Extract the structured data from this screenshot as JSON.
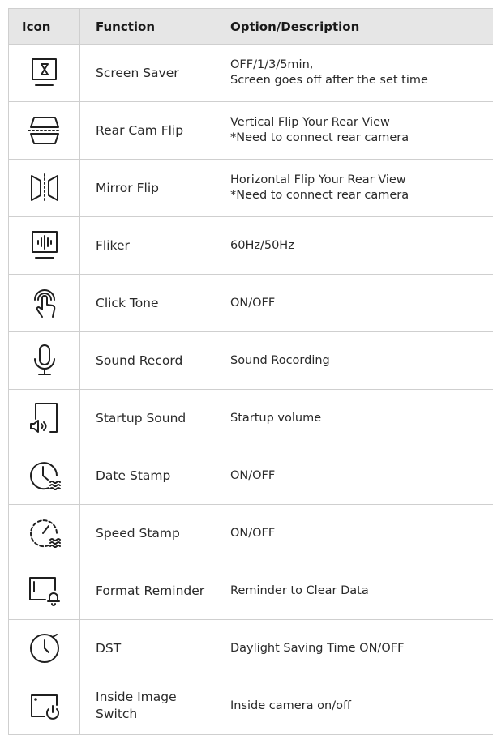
{
  "header": {
    "icon": "Icon",
    "function": "Function",
    "description": "Option/Description"
  },
  "rows": [
    {
      "icon": "screen-saver-icon",
      "function": "Screen Saver",
      "description": [
        "OFF/1/3/5min,",
        "Screen goes off after the set time"
      ]
    },
    {
      "icon": "rear-cam-flip-icon",
      "function": "Rear Cam Flip",
      "description": [
        "Vertical Flip Your Rear View",
        "*Need to connect rear camera"
      ]
    },
    {
      "icon": "mirror-flip-icon",
      "function": "Mirror Flip",
      "description": [
        "Horizontal Flip Your Rear View",
        "*Need to connect rear camera"
      ]
    },
    {
      "icon": "fliker-icon",
      "function": "Fliker",
      "description": [
        "60Hz/50Hz"
      ]
    },
    {
      "icon": "click-tone-icon",
      "function": "Click Tone",
      "description": [
        "ON/OFF"
      ]
    },
    {
      "icon": "microphone-icon",
      "function": "Sound Record",
      "description": [
        "Sound Rocording"
      ]
    },
    {
      "icon": "startup-sound-icon",
      "function": "Startup Sound",
      "description": [
        "Startup volume"
      ]
    },
    {
      "icon": "date-stamp-icon",
      "function": "Date Stamp",
      "description": [
        "ON/OFF"
      ]
    },
    {
      "icon": "speed-stamp-icon",
      "function": "Speed Stamp",
      "description": [
        "ON/OFF"
      ]
    },
    {
      "icon": "format-reminder-icon",
      "function": "Format Reminder",
      "description": [
        "Reminder to Clear Data"
      ]
    },
    {
      "icon": "dst-clock-icon",
      "function": "DST",
      "description": [
        "Daylight Saving Time ON/OFF"
      ]
    },
    {
      "icon": "inside-image-switch-icon",
      "function": [
        "Inside Image",
        "Switch"
      ],
      "description": [
        "Inside camera on/off"
      ]
    }
  ]
}
